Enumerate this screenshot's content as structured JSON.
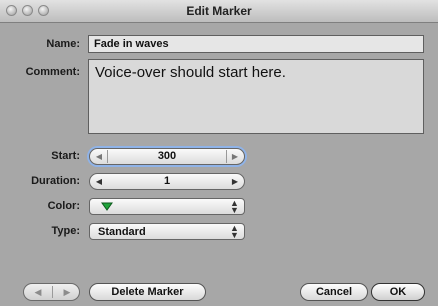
{
  "window": {
    "title": "Edit Marker"
  },
  "form": {
    "name_label": "Name:",
    "name_value": "Fade in waves",
    "comment_label": "Comment:",
    "comment_value": "Voice-over should start here.",
    "start_label": "Start:",
    "start_value": "300",
    "duration_label": "Duration:",
    "duration_value": "1",
    "color_label": "Color:",
    "color_value": "#1fa33a",
    "type_label": "Type:",
    "type_value": "Standard"
  },
  "buttons": {
    "delete_marker": "Delete Marker",
    "cancel": "Cancel",
    "ok": "OK"
  },
  "icons": {
    "prev": "arrow-left-icon",
    "next": "arrow-right-icon",
    "stepper_left": "stepper-left-arrow-icon",
    "stepper_right": "stepper-right-arrow-icon",
    "popup": "popup-updown-icon",
    "color_marker": "green-triangle-marker-icon"
  }
}
